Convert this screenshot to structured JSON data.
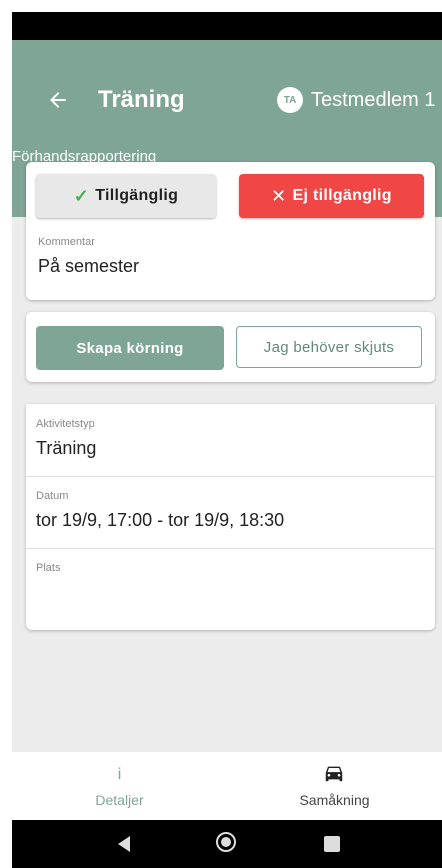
{
  "header": {
    "title": "Träning",
    "user_initials": "TA",
    "user_name": "Testmedlem 1",
    "subtitle": "Förhandsrapportering"
  },
  "availability": {
    "available_label": "Tillgänglig",
    "not_available_label": "Ej tillgänglig",
    "comment_label": "Kommentar",
    "comment_value": "På semester"
  },
  "carpool": {
    "create_label": "Skapa körning",
    "need_ride_label": "Jag behöver skjuts"
  },
  "details": [
    {
      "label": "Aktivitetstyp",
      "value": "Träning"
    },
    {
      "label": "Datum",
      "value": "tor 19/9, 17:00 - tor 19/9, 18:30"
    },
    {
      "label": "Plats",
      "value": ""
    }
  ],
  "bottom_nav": {
    "details_icon": "i",
    "details_label": "Detaljer",
    "ride_label": "Samåkning"
  },
  "colors": {
    "accent": "#7ea596",
    "danger": "#f04646"
  },
  "icons": [
    "back-arrow-icon",
    "check-icon",
    "close-icon",
    "info-icon",
    "car-icon"
  ]
}
